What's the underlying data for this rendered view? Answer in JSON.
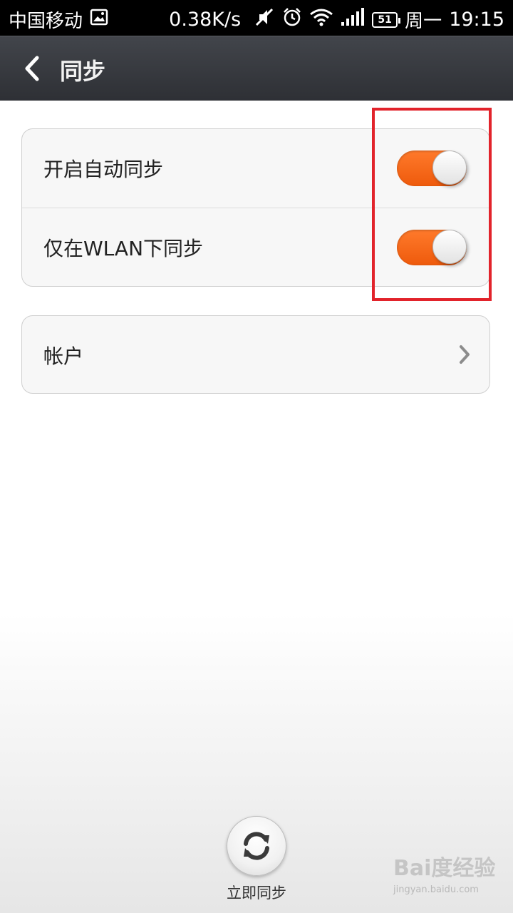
{
  "status_bar": {
    "carrier": "中国移动",
    "speed": "0.38K/s",
    "battery_level": "51",
    "day": "周一",
    "time": "19:15",
    "icons": [
      "image-icon",
      "mute-icon",
      "alarm-icon",
      "wifi-icon",
      "signal-icon",
      "battery-icon"
    ]
  },
  "action_bar": {
    "title": "同步",
    "back_icon": "back-chevron-icon"
  },
  "settings": {
    "sync_group": [
      {
        "label": "开启自动同步",
        "enabled": true
      },
      {
        "label": "仅在WLAN下同步",
        "enabled": true
      }
    ],
    "account": {
      "label": "帐户",
      "icon": "chevron-right-icon"
    }
  },
  "bottom": {
    "sync_now_label": "立即同步",
    "sync_icon": "sync-icon"
  },
  "watermark": {
    "main": "Bai度经验",
    "sub": "jingyan.baidu.com"
  },
  "colors": {
    "toggle_on": "#f0620f",
    "highlight": "#e2232b",
    "action_bar": "#3a3c41"
  }
}
